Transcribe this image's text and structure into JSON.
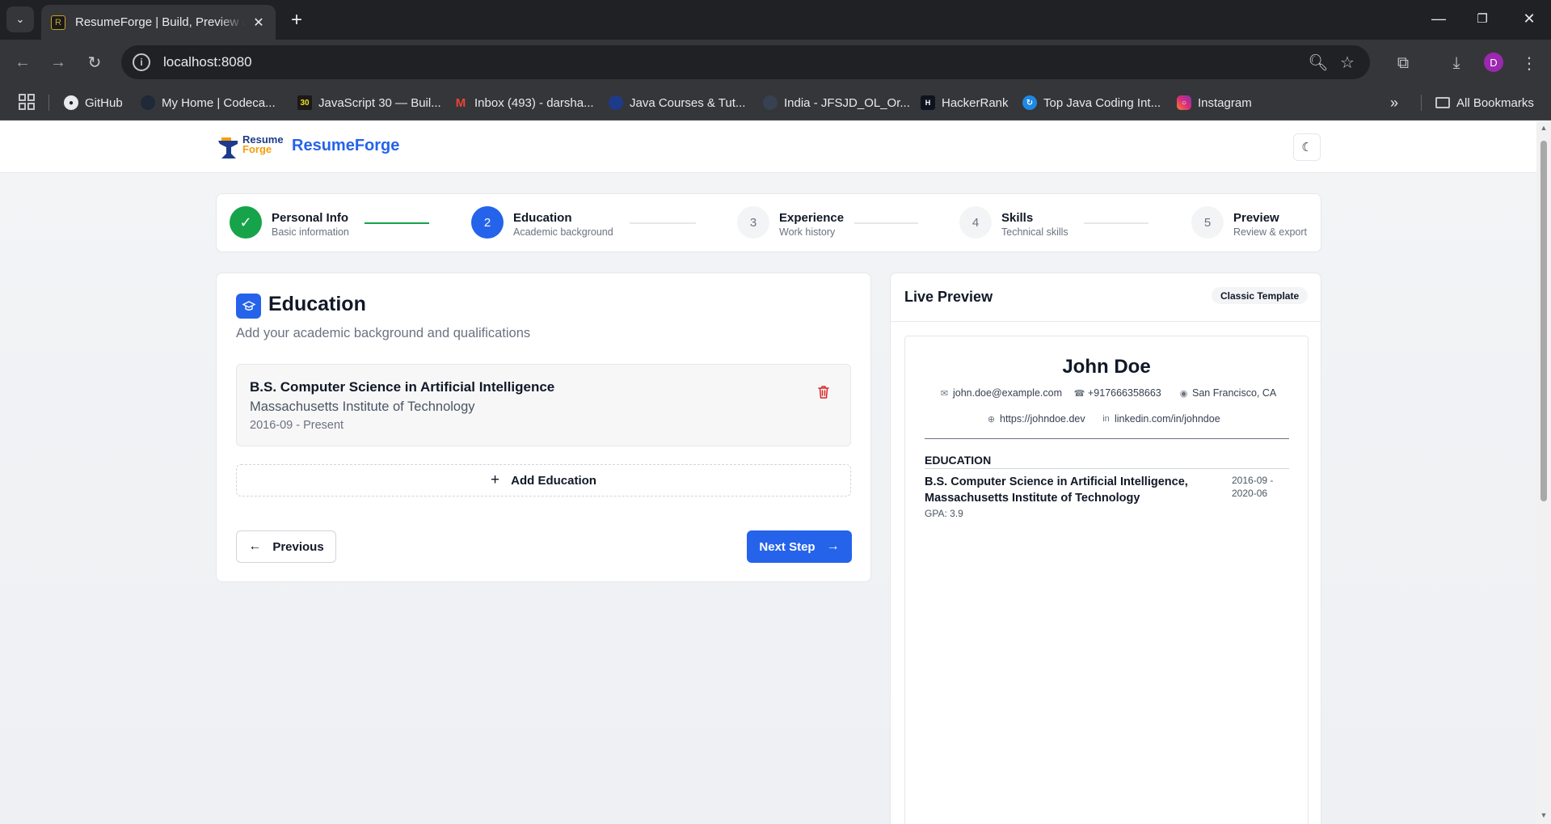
{
  "browser": {
    "tab_title": "ResumeForge | Build, Preview & Export",
    "url": "localhost:8080",
    "profile_initial": "D",
    "bookmarks": [
      {
        "label": "GitHub",
        "icon": "github-icon"
      },
      {
        "label": "My Home | Codeca...",
        "icon": "codecademy-icon"
      },
      {
        "label": "JavaScript 30 — Buil...",
        "icon": "javascript30-icon"
      },
      {
        "label": "Inbox (493) - darsha...",
        "icon": "gmail-icon"
      },
      {
        "label": "Java Courses & Tut...",
        "icon": "java-courses-icon"
      },
      {
        "label": "India - JFSJD_OL_Or...",
        "icon": "india-icon"
      },
      {
        "label": "HackerRank",
        "icon": "hackerrank-icon"
      },
      {
        "label": "Top Java Coding Int...",
        "icon": "coding-interview-icon"
      },
      {
        "label": "Instagram",
        "icon": "instagram-icon"
      }
    ],
    "all_bookmarks_label": "All Bookmarks"
  },
  "app": {
    "brand": "ResumeForge",
    "logo_line1": "Resume",
    "logo_line2": "Forge"
  },
  "steps": [
    {
      "number": "✓",
      "title": "Personal Info",
      "subtitle": "Basic information",
      "state": "complete"
    },
    {
      "number": "2",
      "title": "Education",
      "subtitle": "Academic background",
      "state": "active"
    },
    {
      "number": "3",
      "title": "Experience",
      "subtitle": "Work history",
      "state": "pending"
    },
    {
      "number": "4",
      "title": "Skills",
      "subtitle": "Technical skills",
      "state": "pending"
    },
    {
      "number": "5",
      "title": "Preview",
      "subtitle": "Review & export",
      "state": "pending"
    }
  ],
  "education": {
    "heading": "Education",
    "description": "Add your academic background and qualifications",
    "entries": [
      {
        "degree": "B.S. Computer Science in Artificial Intelligence",
        "school": "Massachusetts Institute of Technology",
        "dates": "2016-09 - Present"
      }
    ],
    "add_label": "Add Education",
    "prev_label": "Previous",
    "next_label": "Next Step"
  },
  "preview": {
    "title": "Live Preview",
    "template_badge": "Classic Template",
    "resume": {
      "name": "John Doe",
      "email": "john.doe@example.com",
      "phone": "+917666358663",
      "location": "San Francisco, CA",
      "website": "https://johndoe.dev",
      "linkedin": "linkedin.com/in/johndoe",
      "section_title": "EDUCATION",
      "edu_degree": "B.S. Computer Science in Artificial Intelligence, Massachusetts Institute of Technology",
      "edu_dates": "2016-09 - 2020-06",
      "edu_gpa": "GPA: 3.9"
    }
  },
  "colors": {
    "primary": "#2563eb",
    "success": "#16a34a",
    "danger": "#dc2626"
  }
}
